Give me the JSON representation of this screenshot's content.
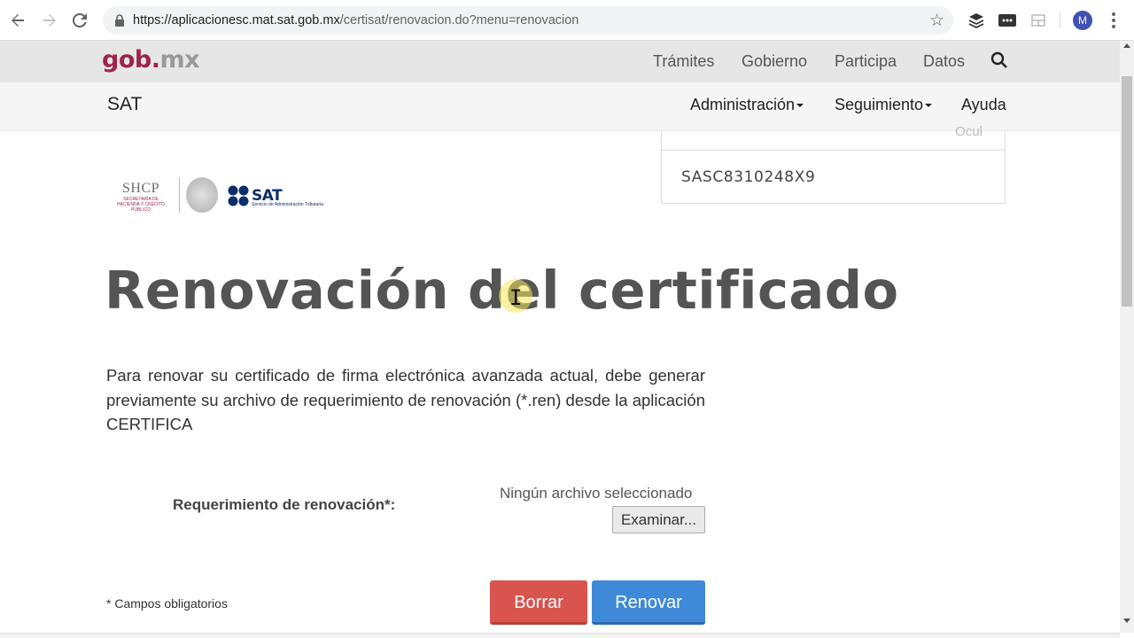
{
  "browser": {
    "url_host": "https://aplicacionesc.mat.sat.gob.mx",
    "url_path": "/certisat/renovacion.do?menu=renovacion",
    "avatar_letter": "M"
  },
  "gob_header": {
    "logo_gob": "gob",
    "logo_dot": ".",
    "logo_mx": "mx",
    "nav": [
      "Trámites",
      "Gobierno",
      "Participa",
      "Datos"
    ]
  },
  "sat_header": {
    "title": "SAT",
    "menu_admin": "Administración",
    "menu_seguimiento": "Seguimiento",
    "menu_ayuda": "Ayuda"
  },
  "logos": {
    "shcp": "SHCP",
    "shcp_sub": "SECRETARÍA DE HACIENDA Y CRÉDITO PÚBLICO",
    "sat": "SAT",
    "sat_sub": "Servicio de Administración Tributaria"
  },
  "rfc_panel": {
    "cut_text": "Ocul",
    "rfc": "SASC8310248X9"
  },
  "main": {
    "title": "Renovación del certificado",
    "intro": "Para renovar su certificado de firma electrónica avanzada actual, debe generar previamente su archivo de requerimiento de renovación (*.ren) desde la aplicación CERTIFICA",
    "req_label": "Requerimiento de renovación*:",
    "file_status": "Ningún archivo seleccionado",
    "browse_label": "Examinar...",
    "required_note": "* Campos obligatorios",
    "clear_label": "Borrar",
    "renew_label": "Renovar"
  },
  "colors": {
    "gob_brand": "#9d2449",
    "sat_blue": "#0b2f6b",
    "clear_button": "#d9534f",
    "renew_button": "#3f8ad8"
  },
  "icons": {
    "back": "back-arrow-icon",
    "forward": "forward-arrow-icon",
    "reload": "reload-icon",
    "lock": "lock-icon",
    "star": "bookmark-star-icon",
    "search": "search-icon"
  }
}
